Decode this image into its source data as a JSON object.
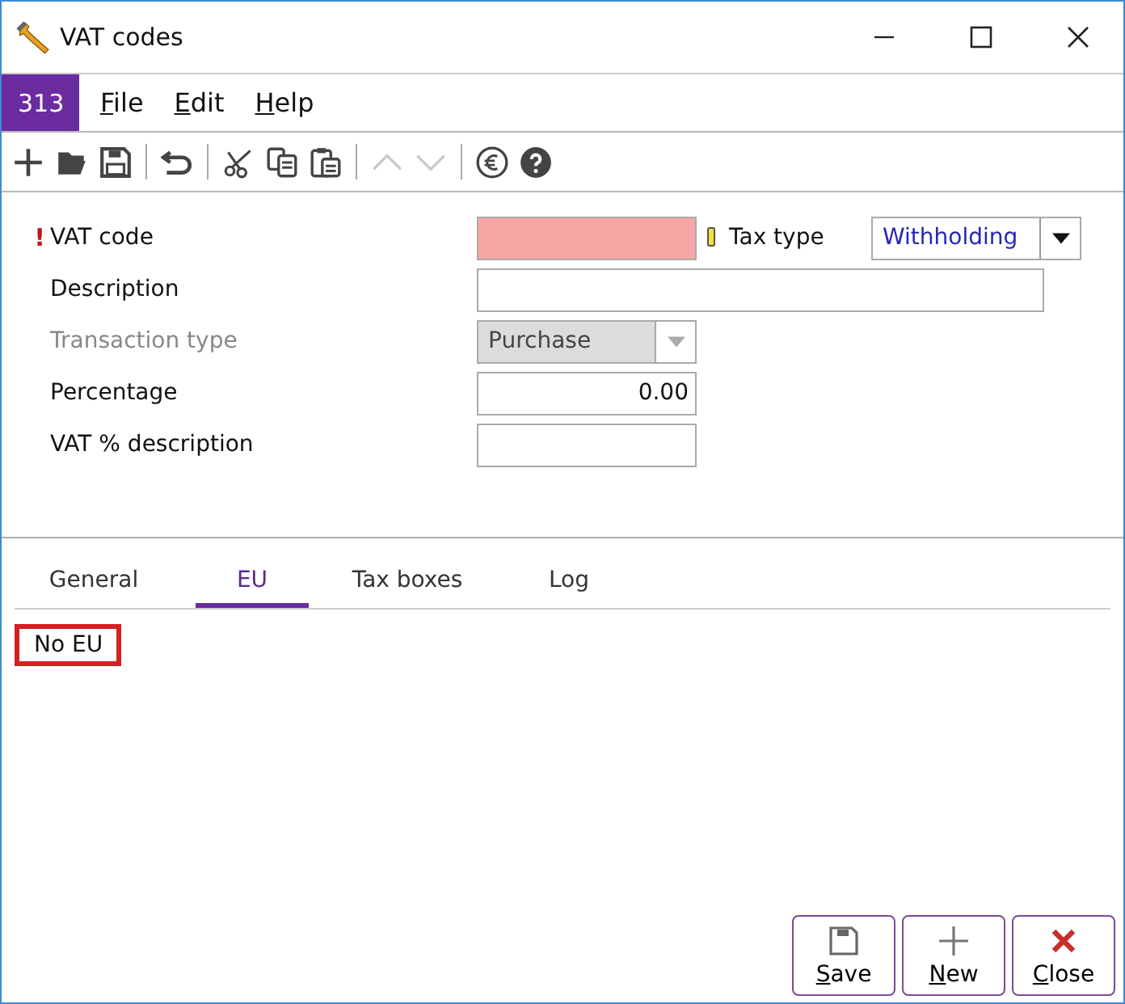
{
  "window": {
    "title": "VAT codes"
  },
  "menu": {
    "badge": "313",
    "items": [
      "File",
      "Edit",
      "Help"
    ]
  },
  "toolbar": [
    {
      "kind": "add",
      "disabled": false
    },
    {
      "kind": "open",
      "disabled": false
    },
    {
      "kind": "save",
      "disabled": false
    },
    {
      "kind": "separator"
    },
    {
      "kind": "undo",
      "disabled": false
    },
    {
      "kind": "separator"
    },
    {
      "kind": "cut",
      "disabled": false
    },
    {
      "kind": "copy",
      "disabled": false
    },
    {
      "kind": "paste",
      "disabled": false
    },
    {
      "kind": "separator"
    },
    {
      "kind": "up",
      "disabled": true
    },
    {
      "kind": "down",
      "disabled": true
    },
    {
      "kind": "separator"
    },
    {
      "kind": "euro",
      "disabled": false
    },
    {
      "kind": "help",
      "disabled": false
    }
  ],
  "form": {
    "fields": [
      {
        "label": "VAT code",
        "kind": "text",
        "required_mark": "!",
        "invalid": true,
        "disabled": false
      },
      {
        "label": "Description",
        "kind": "text_long",
        "disabled": false
      },
      {
        "label": "Transaction type",
        "kind": "select",
        "value": "Purchase",
        "disabled": true
      },
      {
        "label": "Percentage",
        "kind": "number",
        "value": "0.00",
        "disabled": false
      },
      {
        "label": "VAT % description",
        "kind": "text",
        "disabled": false
      }
    ],
    "tax_type": {
      "label": "Tax type",
      "value": "Withholding "
    }
  },
  "tabs": [
    {
      "label": "General",
      "selected": false
    },
    {
      "label": "EU",
      "selected": true
    },
    {
      "label": "Tax boxes",
      "selected": false
    },
    {
      "label": "Log",
      "selected": false
    }
  ],
  "tab_content": {
    "text": "No EU",
    "highlighted": true
  },
  "buttons": [
    {
      "label": "Save",
      "kind": "save"
    },
    {
      "label": "New",
      "kind": "new"
    },
    {
      "label": "Close",
      "kind": "close"
    }
  ]
}
